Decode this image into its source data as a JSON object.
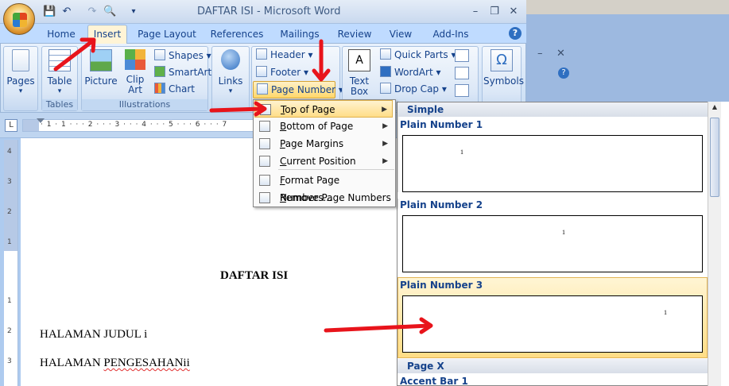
{
  "window": {
    "title": "DAFTAR ISI - Microsoft Word",
    "controls": [
      "–",
      "❐",
      "✕"
    ],
    "help_glyph": "?"
  },
  "qat": {
    "save": "💾",
    "undo": "↶",
    "redo": "↷",
    "preview": "🔍",
    "customize": "▾"
  },
  "tabs": [
    {
      "label": "Home"
    },
    {
      "label": "Insert",
      "active": true
    },
    {
      "label": "Page Layout"
    },
    {
      "label": "References"
    },
    {
      "label": "Mailings"
    },
    {
      "label": "Review"
    },
    {
      "label": "View"
    },
    {
      "label": "Add-Ins"
    }
  ],
  "ribbon": {
    "pages": {
      "label": "Pages",
      "dropdown": "▾"
    },
    "tables_group": {
      "table": "Table",
      "dropdown": "▾",
      "group_label": "Tables"
    },
    "illustrations": {
      "picture": "Picture",
      "clip_art_1": "Clip",
      "clip_art_2": "Art",
      "shapes": "Shapes",
      "smartart": "SmartArt",
      "chart": "Chart",
      "group_label": "Illustrations"
    },
    "links": {
      "label": "Links",
      "dropdown": "▾"
    },
    "header_footer": {
      "header": "Header",
      "footer": "Footer",
      "page_number": "Page Number"
    },
    "text": {
      "textbox_1": "Text",
      "textbox_2": "Box",
      "quick_parts": "Quick Parts",
      "wordart": "WordArt",
      "drop_cap": "Drop Cap"
    },
    "symbols": {
      "label": "Symbols",
      "omega": "Ω"
    }
  },
  "ruler": {
    "corner": "L",
    "ticks": "· 1 · 1 · · · 2 · · · 3 · · · 4 · · · 5 · · · 6 · · · 7"
  },
  "vruler": {
    "ticks": [
      "4",
      "3",
      "2",
      "1",
      "1",
      "2",
      "3"
    ]
  },
  "document": {
    "title": "DAFTAR ISI",
    "line1": "HALAMAN JUDUL i",
    "line2_a": "HALAMAN ",
    "line2_b": "PENGESAHANii"
  },
  "page_number_menu": [
    {
      "label": "Top of Page",
      "underline_char": "T",
      "rest": "op of Page",
      "submenu": true
    },
    {
      "label": "Bottom of Page",
      "underline_char": "B",
      "rest": "ottom of Page",
      "submenu": true
    },
    {
      "label": "Page Margins",
      "underline_char": "P",
      "rest": "age Margins",
      "submenu": true
    },
    {
      "label": "Current Position",
      "underline_char": "C",
      "rest": "urrent Position",
      "submenu": true
    },
    {
      "label": "Format Page Numbers...",
      "underline_char": "F",
      "rest": "ormat Page Numbers...",
      "submenu": false
    },
    {
      "label": "Remove Page Numbers",
      "underline_char": "R",
      "rest": "emove Page Numbers",
      "submenu": false
    }
  ],
  "gallery": {
    "section_simple": "Simple",
    "items": [
      {
        "label": "Plain Number 1",
        "number": "1"
      },
      {
        "label": "Plain Number 2",
        "number": "1"
      },
      {
        "label": "Plain Number 3",
        "number": "1",
        "selected": true
      }
    ],
    "section_page_x": "Page X",
    "accent_label": "Accent Bar 1",
    "scroll_up": "▲"
  },
  "colors": {
    "accent": "#15428b",
    "highlight": "#ffdd86",
    "arrow": "#e8141b"
  }
}
